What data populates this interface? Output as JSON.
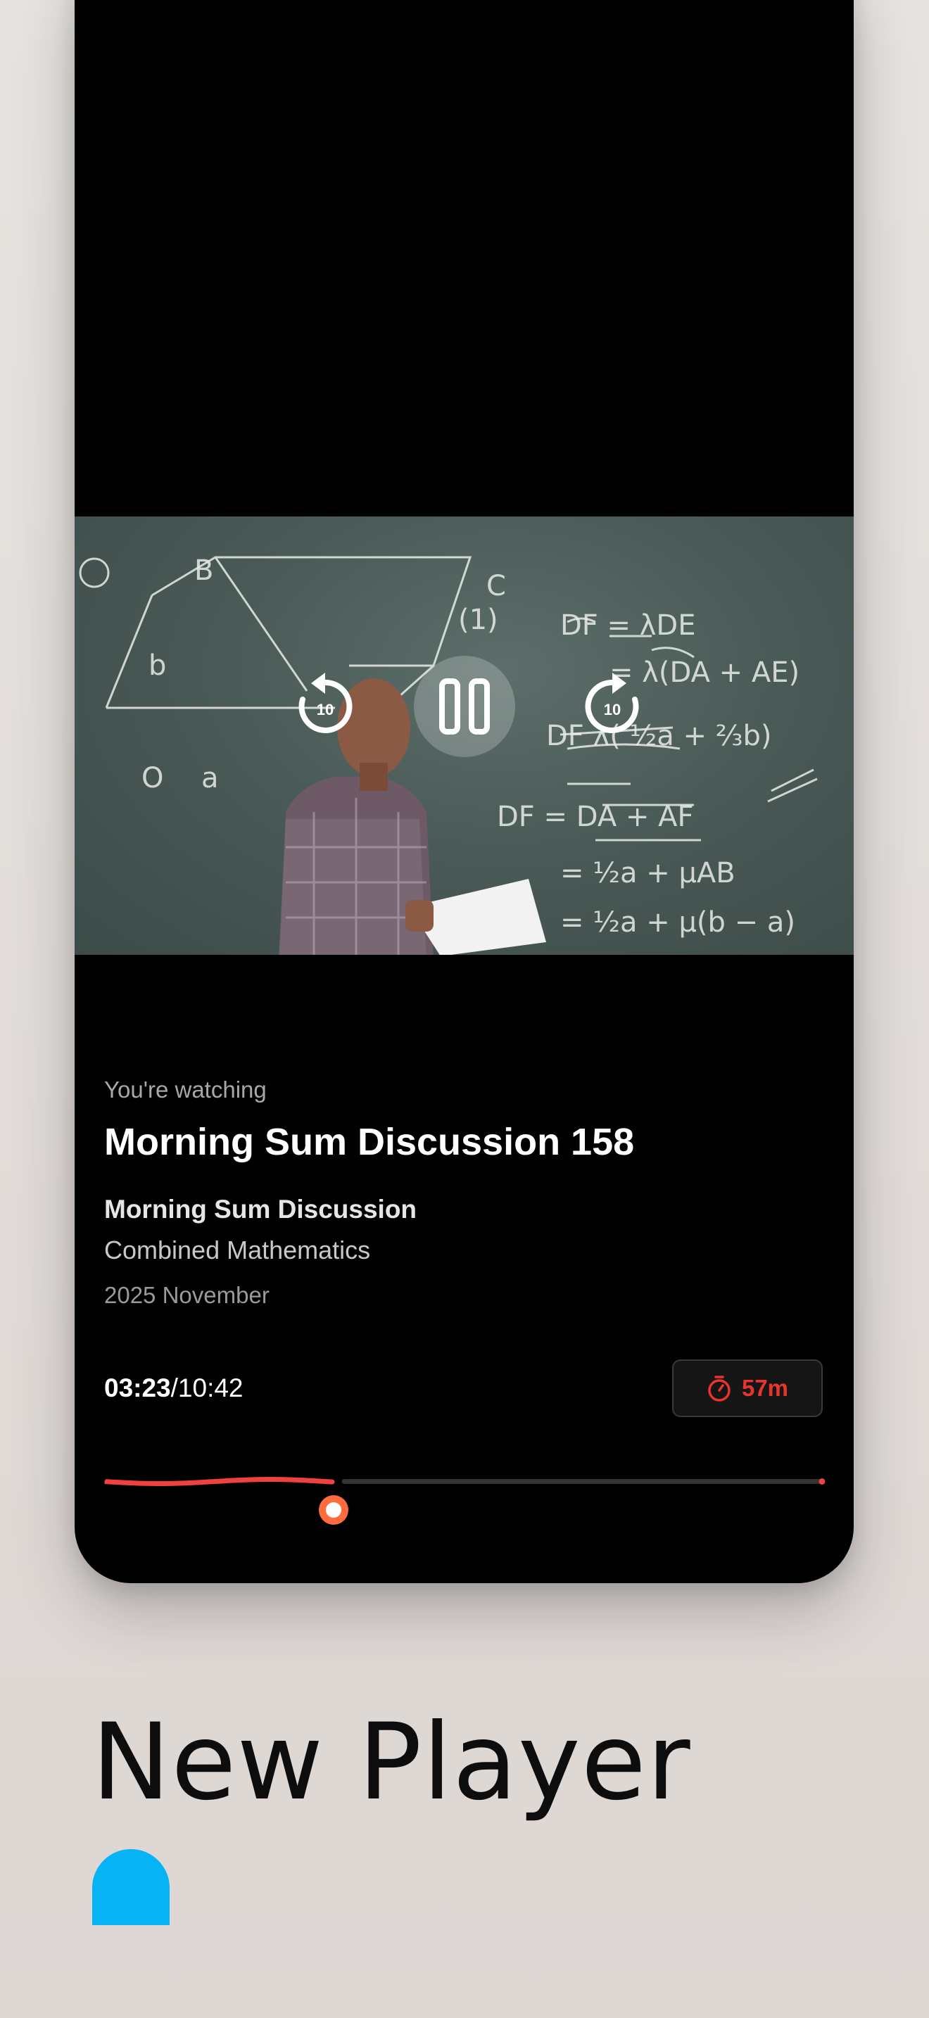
{
  "video": {
    "rewind_label": "10",
    "forward_label": "10"
  },
  "now_playing": {
    "caption": "You're watching",
    "title": "Morning Sum Discussion 158",
    "series": "Morning Sum Discussion",
    "subject": "Combined Mathematics",
    "date": "2025 November"
  },
  "playback": {
    "current_time": "03:23",
    "separator": "/",
    "total_time": "10:42",
    "progress_fraction": 0.318,
    "sleep_timer_label": "57m"
  },
  "colors": {
    "accent_red": "#e8342d",
    "progress_red": "#f04040",
    "thumb_orange": "#ff6b3d",
    "bubble_blue": "#06b3f5"
  },
  "promo": {
    "heading": "New Player"
  }
}
